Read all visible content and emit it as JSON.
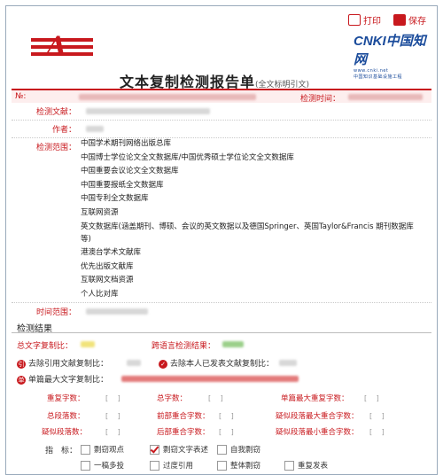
{
  "header": {
    "print_label": "打印",
    "save_label": "保存",
    "logo_letter": "A",
    "cnki_mark": "CNKI中国知网",
    "cnki_sub": "www.cnki.net",
    "cnki_tag": "中国知识基础设施工程"
  },
  "report": {
    "title": "文本复制检测报告单",
    "subtitle": "(全文标明引文)",
    "id_label": "№:",
    "time_label": "检测时间："
  },
  "info": {
    "doc_label": "检测文献：",
    "author_label": "作者：",
    "scope_label": "检测范围：",
    "period_label": "时间范围：",
    "databases": [
      "中国学术期刊网络出版总库",
      "中国博士学位论文全文数据库/中国优秀硕士学位论文全文数据库",
      "中国重要会议论文全文数据库",
      "中国重要报纸全文数据库",
      "中国专利全文数据库",
      "互联网资源",
      "英文数据库(涵盖期刊、博硕、会议的英文数据以及德国Springer、英国Taylor&Francis 期刊数据库等)",
      "港澳台学术文献库",
      "优先出版文献库",
      "互联网文档资源",
      "个人比对库"
    ]
  },
  "results": {
    "heading": "检测结果",
    "total_label": "总文字复制比：",
    "cross_label": "跨语言检测结果：",
    "excl_ref_label": "去除引用文献复制比：",
    "excl_self_label": "去除本人已发表文献复制比：",
    "single_max_label": "单篇最大文字复制比：",
    "grid": [
      [
        "重复字数：",
        "总字数：",
        "单篇最大重复字数："
      ],
      [
        "总段落数：",
        "前部重合字数：",
        "疑似段落最大重合字数："
      ],
      [
        "疑似段落数：",
        "后部重合字数：",
        "疑似段落最小重合字数："
      ]
    ],
    "indicators_label": "指　标：",
    "indicators": [
      {
        "label": "剽窃观点",
        "checked": false
      },
      {
        "label": "剽窃文字表述",
        "checked": true
      },
      {
        "label": "自我剽窃",
        "checked": false
      },
      {
        "label": "一稿多投",
        "checked": false
      },
      {
        "label": "过度引用",
        "checked": false
      },
      {
        "label": "整体剽窃",
        "checked": false
      },
      {
        "label": "重复发表",
        "checked": false
      }
    ]
  },
  "colors": {
    "accent": "#c8191e",
    "brand_blue": "#1a4b9b"
  }
}
